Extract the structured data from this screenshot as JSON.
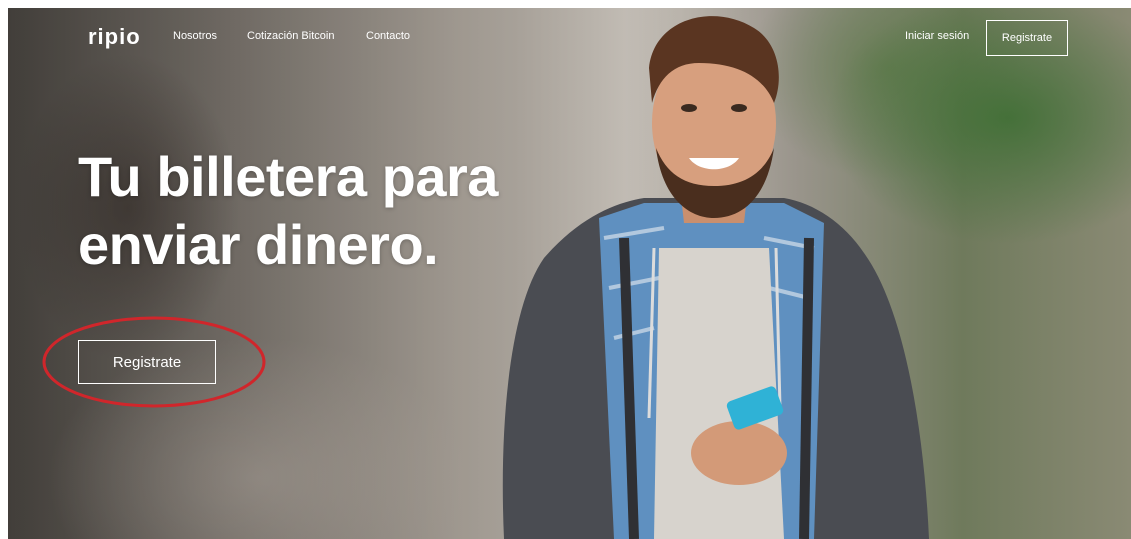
{
  "brand": {
    "logo_text": "ripio"
  },
  "nav": {
    "links": [
      "Nosotros",
      "Cotización Bitcoin",
      "Contacto"
    ],
    "login_label": "Iniciar sesión",
    "register_label": "Registrate"
  },
  "hero": {
    "headline_line1": "Tu billetera para",
    "headline_line2": "enviar dinero.",
    "cta_label": "Registrate"
  },
  "colors": {
    "text": "#ffffff",
    "annotation": "#d0262b",
    "phone": "#2fb2d6"
  },
  "icons": {
    "annotation": "red-ellipse-annotation"
  }
}
